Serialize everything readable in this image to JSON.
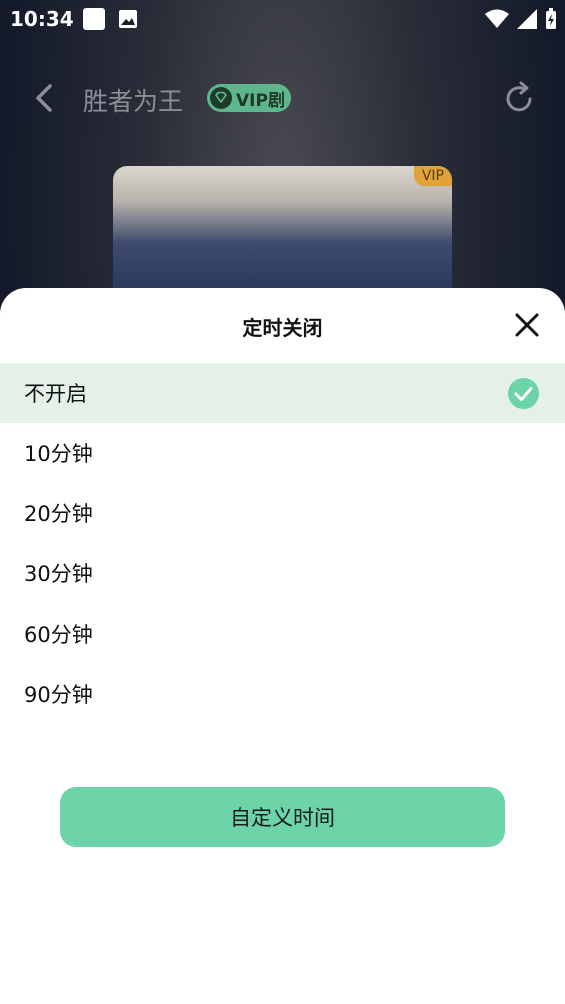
{
  "status_bar": {
    "time": "10:34"
  },
  "header": {
    "title": "胜者为王",
    "vip_badge": "VIP剧"
  },
  "poster": {
    "badge": "VIP"
  },
  "sheet": {
    "title": "定时关闭",
    "options": [
      {
        "label": "不开启",
        "selected": true
      },
      {
        "label": "10分钟",
        "selected": false
      },
      {
        "label": "20分钟",
        "selected": false
      },
      {
        "label": "30分钟",
        "selected": false
      },
      {
        "label": "60分钟",
        "selected": false
      },
      {
        "label": "90分钟",
        "selected": false
      }
    ],
    "custom_button": "自定义时间"
  },
  "colors": {
    "accent": "#6cd4a8",
    "selected_bg": "#e3f1e9",
    "check": "#6cd4a8"
  },
  "icons": [
    "back-icon",
    "vip-gem-icon",
    "refresh-icon",
    "close-icon",
    "check-icon",
    "wifi-icon",
    "signal-icon",
    "battery-icon"
  ]
}
